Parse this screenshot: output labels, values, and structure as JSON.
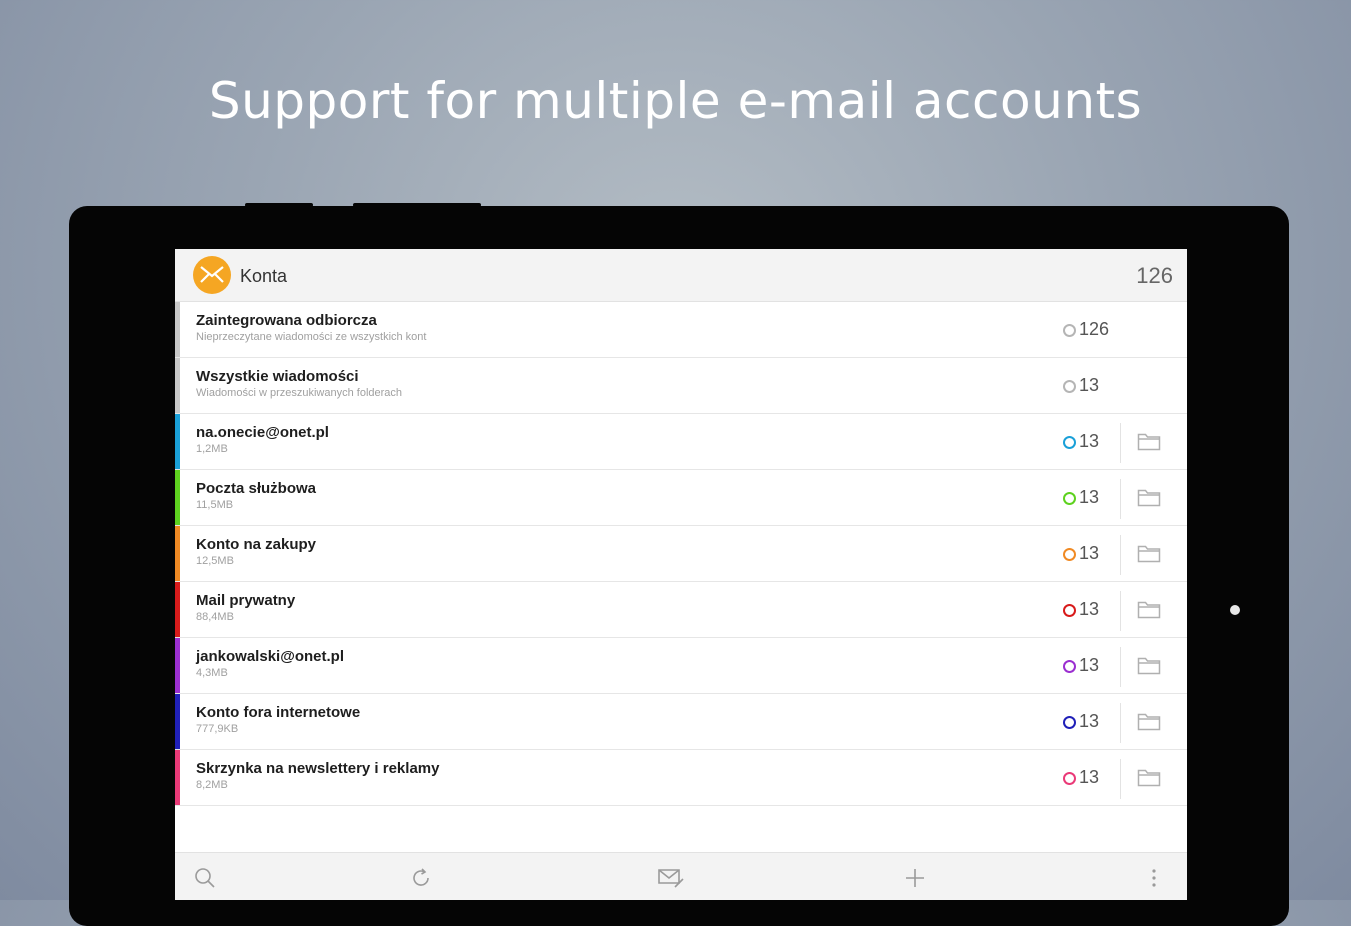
{
  "headline": "Support for multiple e-mail accounts",
  "appbar": {
    "title": "Konta",
    "count": "126",
    "logo_icon": "envelope-icon",
    "logo_color": "#f5a623"
  },
  "accounts": [
    {
      "name": "Zaintegrowana odbiorcza",
      "sub": "Nieprzeczytane wiadomości ze wszystkich kont",
      "count": "126",
      "color": "#c8c8c8",
      "ring": "#b5b5b5",
      "has_folder": false
    },
    {
      "name": "Wszystkie wiadomości",
      "sub": "Wiadomości w przeszukiwanych folderach",
      "count": "13",
      "color": "#c8c8c8",
      "ring": "#b5b5b5",
      "has_folder": false
    },
    {
      "name": "na.onecie@onet.pl",
      "sub": "1,2MB",
      "count": "13",
      "color": "#1aa0d8",
      "ring": "#1aa0d8",
      "has_folder": true
    },
    {
      "name": "Poczta służbowa",
      "sub": "11,5MB",
      "count": "13",
      "color": "#5ed21f",
      "ring": "#5ed21f",
      "has_folder": true
    },
    {
      "name": "Konto na zakupy",
      "sub": "12,5MB",
      "count": "13",
      "color": "#f08a24",
      "ring": "#f08a24",
      "has_folder": true
    },
    {
      "name": "Mail prywatny",
      "sub": "88,4MB",
      "count": "13",
      "color": "#d81b1b",
      "ring": "#d81b1b",
      "has_folder": true
    },
    {
      "name": "jankowalski@onet.pl",
      "sub": "4,3MB",
      "count": "13",
      "color": "#9b2fd0",
      "ring": "#9b2fd0",
      "has_folder": true
    },
    {
      "name": "Konto fora internetowe",
      "sub": "777,9KB",
      "count": "13",
      "color": "#2020b8",
      "ring": "#2020b8",
      "has_folder": true
    },
    {
      "name": "Skrzynka na newslettery i reklamy",
      "sub": "8,2MB",
      "count": "13",
      "color": "#ea3a78",
      "ring": "#ea3a78",
      "has_folder": true
    }
  ],
  "toolbar": {
    "icons": [
      "search-icon",
      "refresh-icon",
      "compose-icon",
      "add-icon",
      "more-icon"
    ]
  }
}
